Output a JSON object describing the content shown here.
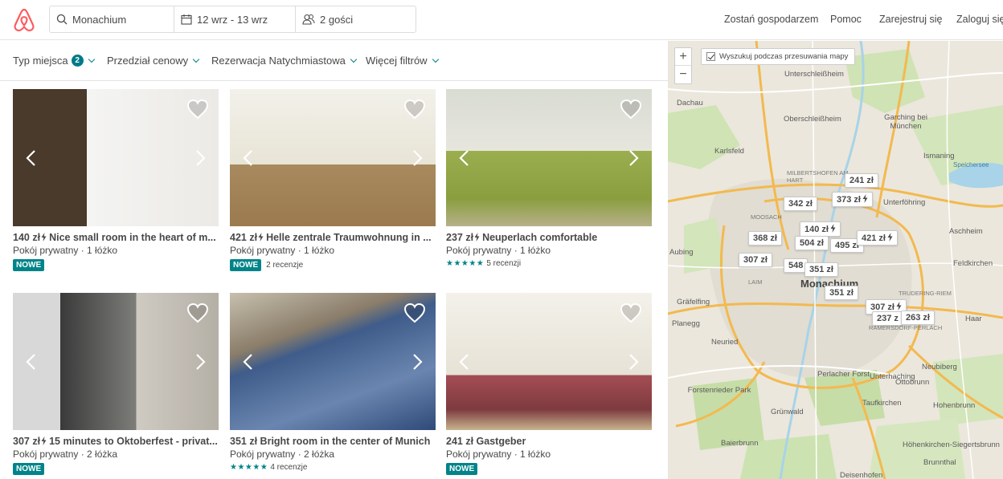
{
  "header": {
    "search": {
      "location": "Monachium",
      "dates": "12 wrz - 13 wrz",
      "guests": "2 gości"
    },
    "nav": [
      "Zostań gospodarzem",
      "Pomoc",
      "Zarejestruj się",
      "Zaloguj się"
    ]
  },
  "filters": {
    "place_type": "Typ miejsca",
    "place_type_count": "2",
    "price_range": "Przedział cenowy",
    "instant_book": "Rezerwacja Natychmiastowa",
    "more_filters": "Więcej filtrów"
  },
  "listings": [
    {
      "price": "140 zł",
      "instant": true,
      "name": "Nice small room in the heart of m...",
      "type": "Pokój prywatny · 1 łóżko",
      "new": "NOWE",
      "stars": "",
      "reviews": ""
    },
    {
      "price": "421 zł",
      "instant": true,
      "name": "Helle zentrale Traumwohnung in ...",
      "type": "Pokój prywatny · 1 łóżko",
      "new": "NOWE",
      "stars": "",
      "reviews": "2 recenzje"
    },
    {
      "price": "237 zł",
      "instant": true,
      "name": "Neuperlach comfortable",
      "type": "Pokój prywatny · 1 łóżko",
      "new": "",
      "stars": "★★★★★",
      "reviews": "5 recenzji"
    },
    {
      "price": "307 zł",
      "instant": true,
      "name": "15 minutes to Oktoberfest - privat...",
      "type": "Pokój prywatny · 2 łóżka",
      "new": "NOWE",
      "stars": "",
      "reviews": ""
    },
    {
      "price": "351 zł",
      "instant": false,
      "name": "Bright room in the center of Munich",
      "type": "Pokój prywatny · 2 łóżka",
      "new": "",
      "stars": "★★★★★",
      "reviews": "4 recenzje"
    },
    {
      "price": "241 zł",
      "instant": false,
      "name": "Gastgeber",
      "type": "Pokój prywatny · 1 łóżko",
      "new": "NOWE",
      "stars": "",
      "reviews": ""
    }
  ],
  "map": {
    "zoom_in": "+",
    "zoom_out": "−",
    "search_on_move": "Wyszukuj podczas przesuwania mapy",
    "pins": [
      {
        "label": "241 zł",
        "instant": false
      },
      {
        "label": "373 zł",
        "instant": true
      },
      {
        "label": "342 zł",
        "instant": false
      },
      {
        "label": "140 zł",
        "instant": true
      },
      {
        "label": "368 zł",
        "instant": false
      },
      {
        "label": "504 zł",
        "instant": false
      },
      {
        "label": "495 zł",
        "instant": false
      },
      {
        "label": "421 zł",
        "instant": true
      },
      {
        "label": "307 zł",
        "instant": false
      },
      {
        "label": "548",
        "instant": false
      },
      {
        "label": "351 zł",
        "instant": false
      },
      {
        "label": "351 zł",
        "instant": false
      },
      {
        "label": "307 zł",
        "instant": true
      },
      {
        "label": "237 z",
        "instant": false
      },
      {
        "label": "263 zł",
        "instant": false
      }
    ],
    "places": [
      "Unterschleißheim",
      "Dachau",
      "Oberschleißheim",
      "Garching bei München",
      "Karlsfeld",
      "Ismaning",
      "MILBERTSHOFEN AM HART",
      "Unterföhring",
      "MOOSACH",
      "Aschheim",
      "Monachium",
      "Feldkirchen",
      "LAIM",
      "TRUDERING-RIEM",
      "Gräfelfing",
      "Planegg",
      "RAMERSDORF-PERLACH",
      "Haar",
      "Neuried",
      "Perlacher Forst",
      "Unterhaching",
      "Neubiberg",
      "Forstenrieder Park",
      "Ottobrunn",
      "Taufkirchen",
      "Grünwald",
      "Hohenbrunn",
      "Baierbrunn",
      "Höhenkirchen-Siegertsbrunn",
      "Brunnthal",
      "Deisenhofen",
      "Speichersee",
      "Aubing"
    ]
  },
  "colors": {
    "brand": "#FF5A5F",
    "accent": "#008489",
    "badge": "#007A87"
  }
}
